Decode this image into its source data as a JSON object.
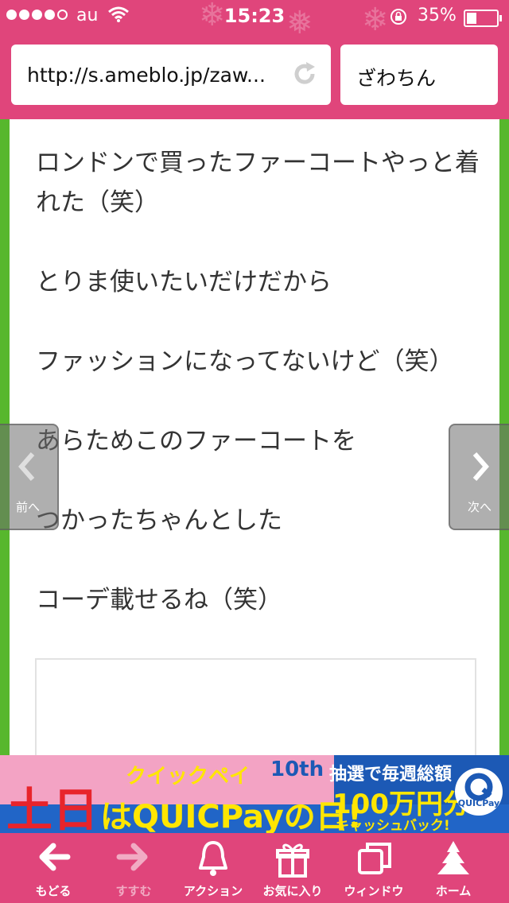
{
  "status_bar": {
    "carrier": "au",
    "time": "15:23",
    "battery": "35%"
  },
  "browser": {
    "url": "http://s.ameblo.jp/zaw...",
    "page_title": "ざわちん"
  },
  "article": {
    "paragraphs": [
      "ロンドンで買ったファーコートやっと着れた（笑）",
      "とりま使いたいだけだから",
      "ファッションになってないけど（笑）",
      "あらためこのファーコートを",
      "つかったちゃんとした",
      "コーデ載せるね（笑）"
    ]
  },
  "side_nav": {
    "prev_label": "前へ",
    "next_label": "次へ"
  },
  "ad": {
    "big_char": "土日",
    "katakana": "クイックペイ",
    "anniversary": "10th",
    "main": "はQUICPayの日!",
    "right_top": "抽選で毎週総額",
    "amount": "100万円分",
    "right_bottom": "キャッシュバック!",
    "logo_text": "QUICPay"
  },
  "toolbar": {
    "items": [
      {
        "label": "もどる",
        "icon": "back-arrow-icon"
      },
      {
        "label": "すすむ",
        "icon": "forward-arrow-icon"
      },
      {
        "label": "アクション",
        "icon": "bell-icon"
      },
      {
        "label": "お気に入り",
        "icon": "gift-icon"
      },
      {
        "label": "ウィンドウ",
        "icon": "windows-icon"
      },
      {
        "label": "ホーム",
        "icon": "tree-icon"
      }
    ]
  },
  "colors": {
    "brand_pink": "#e0457b",
    "frame_green": "#57b72d"
  }
}
